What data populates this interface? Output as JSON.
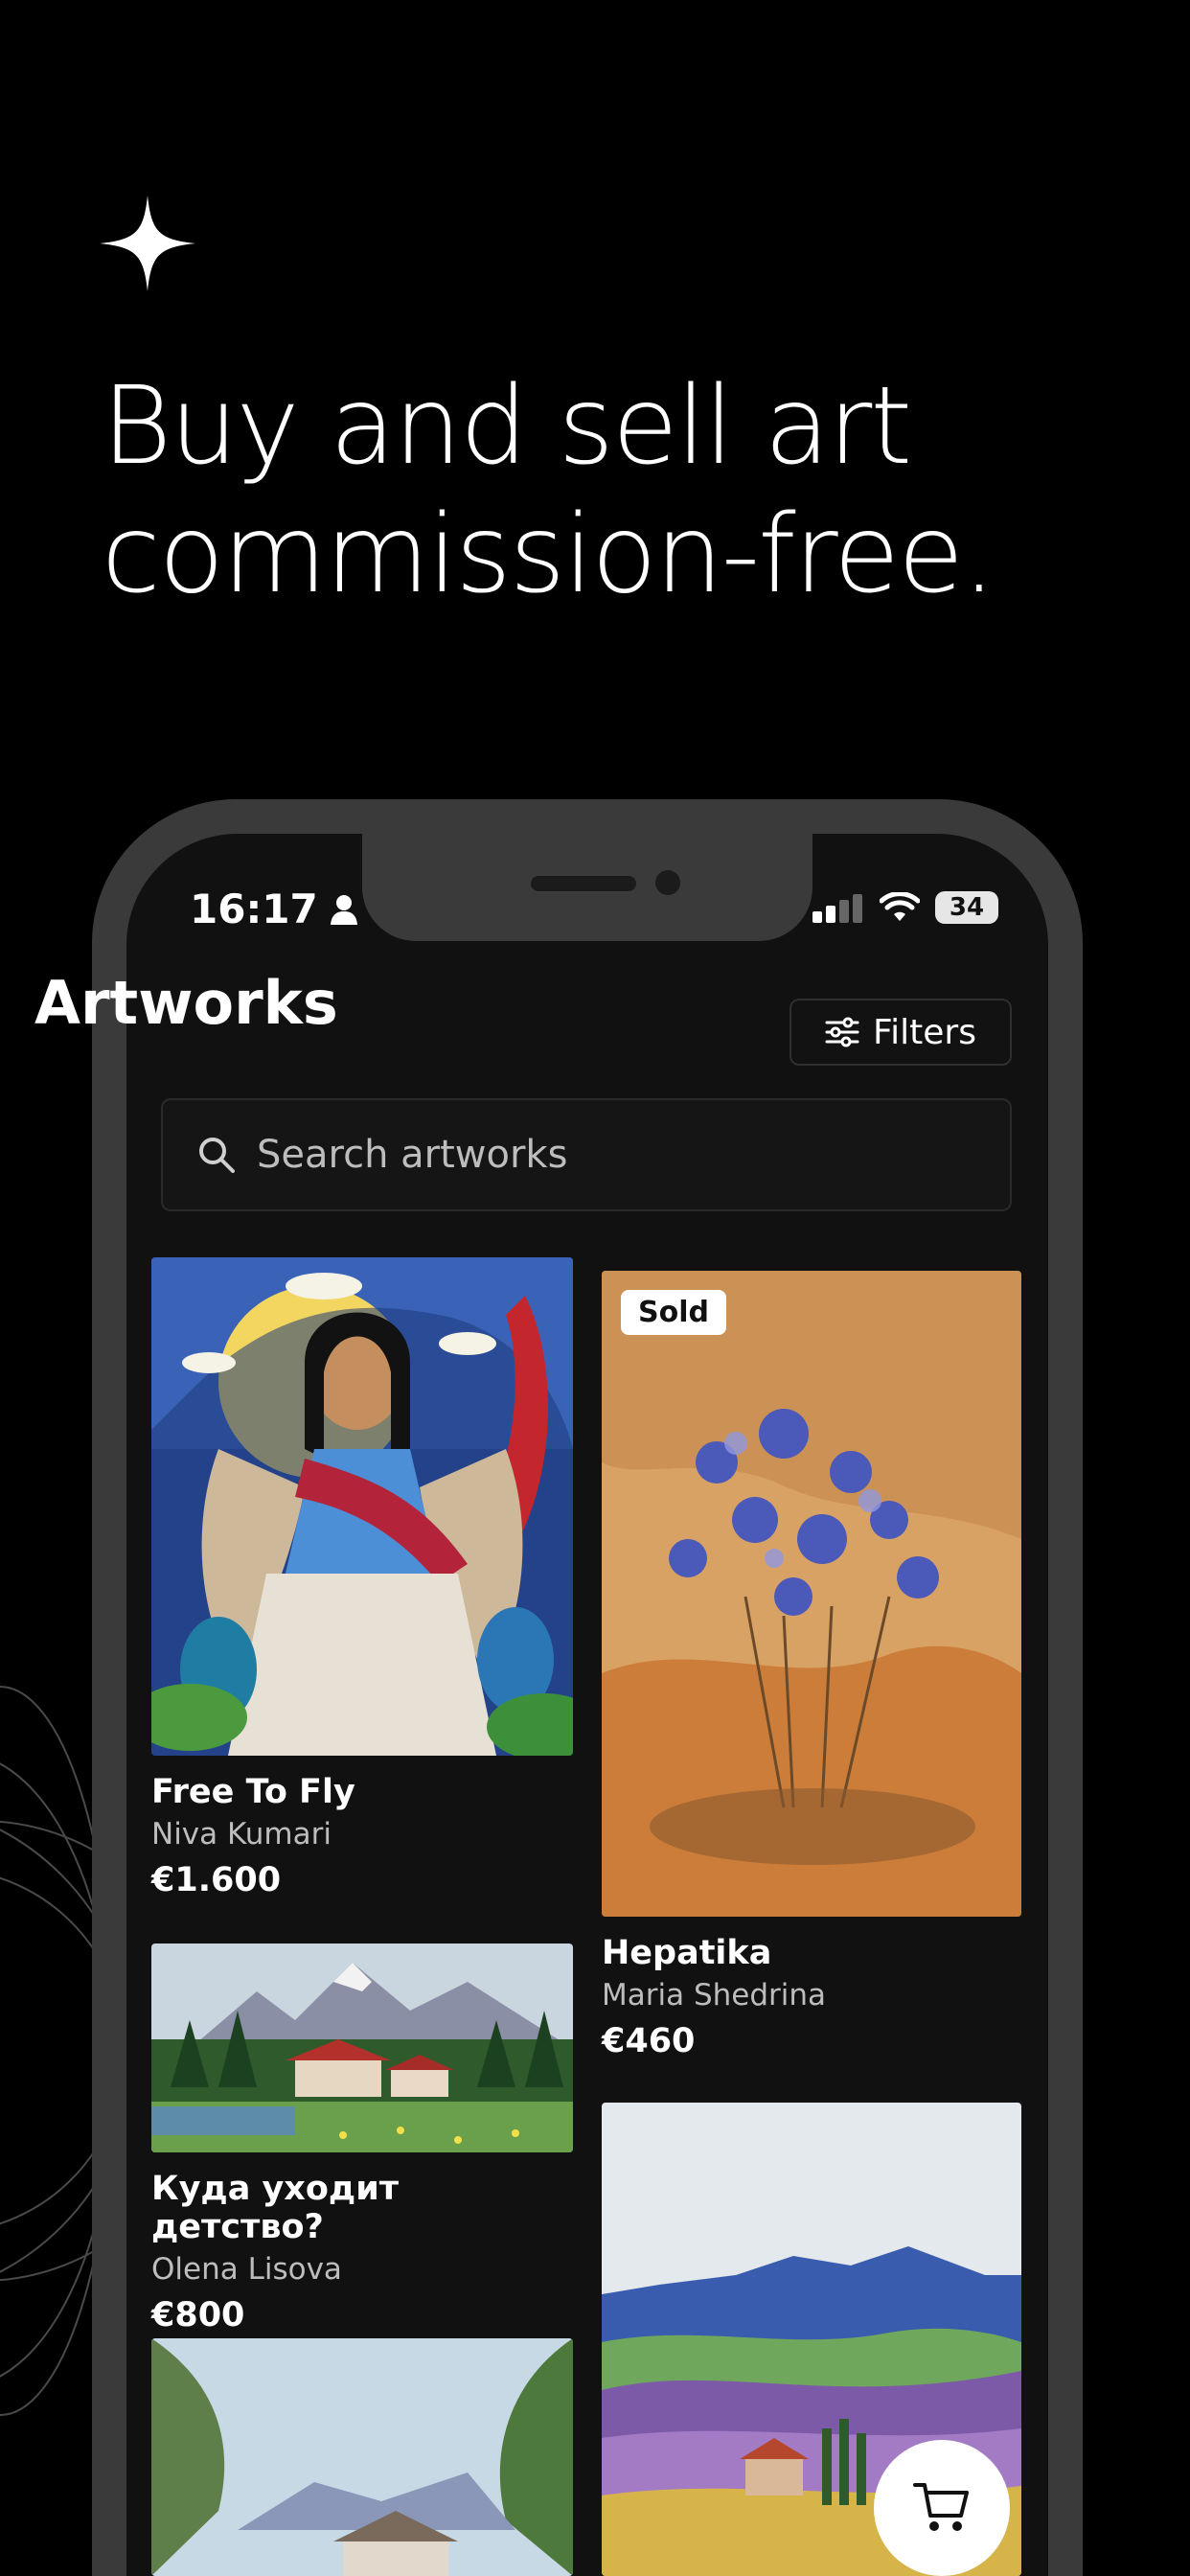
{
  "hero": {
    "line1": "Buy and sell art",
    "line2": "commission-free."
  },
  "status": {
    "time": "16:17",
    "battery": "34"
  },
  "header": {
    "title": "Artworks",
    "filters_label": "Filters"
  },
  "search": {
    "placeholder": "Search artworks"
  },
  "artworks": [
    {
      "title": "Free To Fly",
      "artist": "Niva Kumari",
      "price": "€1.600",
      "badge": ""
    },
    {
      "title": "Hepatika",
      "artist": "Maria Shedrina",
      "price": "€460",
      "badge": "Sold"
    },
    {
      "title": "Куда уходит детство?",
      "artist": "Olena  Lisova",
      "price": "€800",
      "badge": ""
    },
    {
      "title": "",
      "artist": "",
      "price": "",
      "badge": ""
    },
    {
      "title": "",
      "artist": "",
      "price": "",
      "badge": ""
    }
  ],
  "colors": {
    "background": "#000000",
    "phone_frame": "#3a3a3a",
    "screen": "#111111",
    "accent": "#ffffff"
  },
  "icons": [
    "sparkle-icon",
    "person-icon",
    "signal-icon",
    "wifi-icon",
    "battery-icon",
    "sliders-icon",
    "search-icon",
    "cart-icon"
  ]
}
